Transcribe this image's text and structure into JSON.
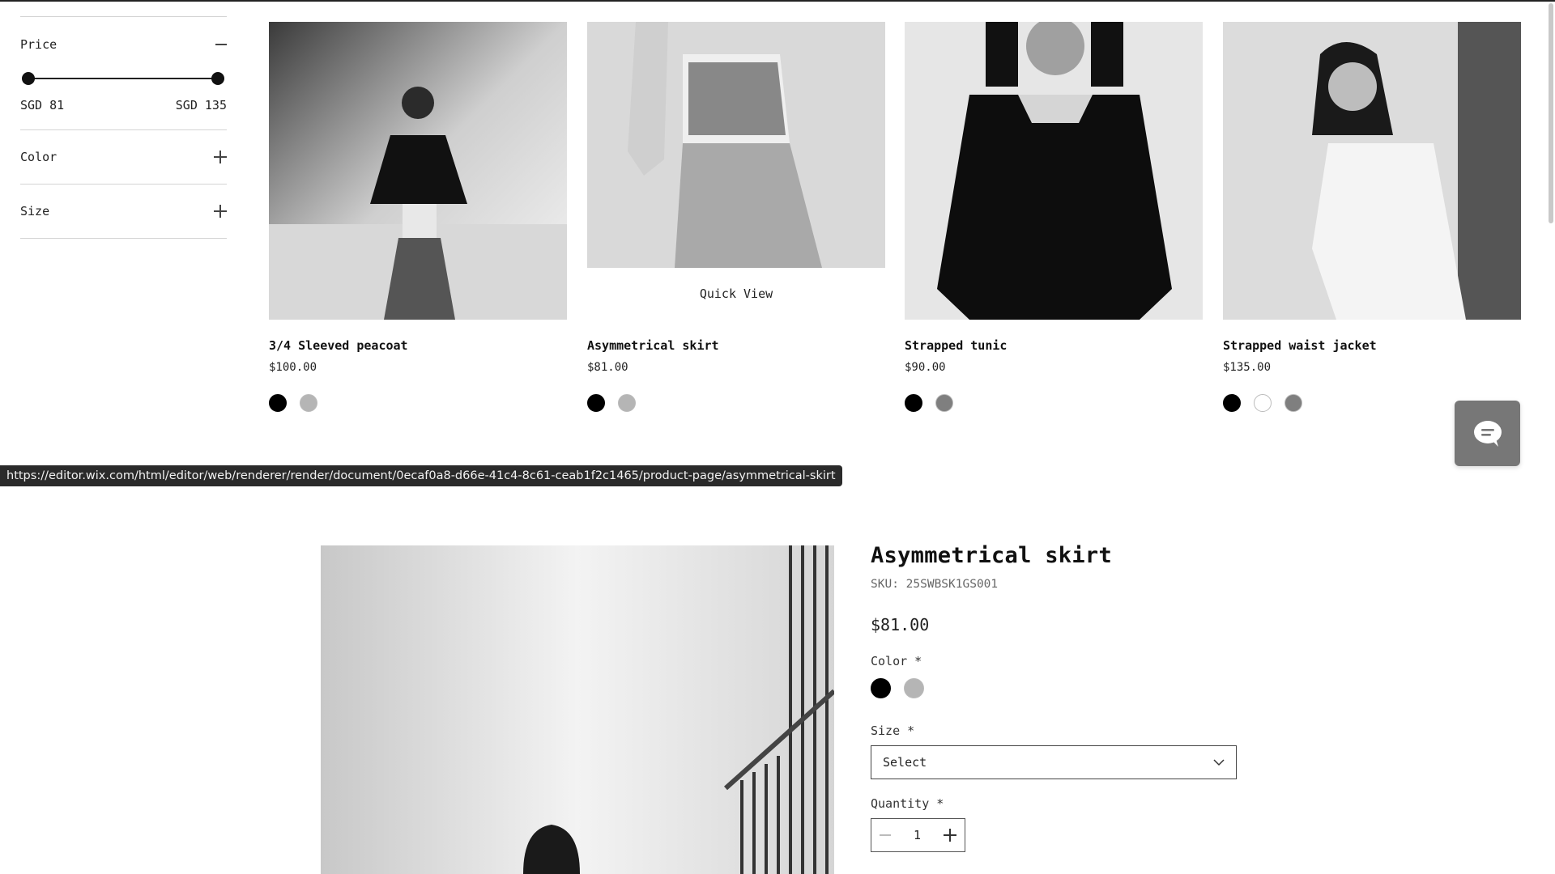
{
  "filters": {
    "price": {
      "label": "Price",
      "min_label": "SGD 81",
      "max_label": "SGD 135",
      "selected_min_fraction": 0.0,
      "selected_max_fraction": 1.0
    },
    "color": {
      "label": "Color"
    },
    "size": {
      "label": "Size"
    }
  },
  "products": [
    {
      "name": "3/4 Sleeved peacoat",
      "price": "$100.00",
      "swatches": [
        "#000000",
        "#b5b5b5"
      ]
    },
    {
      "name": "Asymmetrical skirt",
      "price": "$81.00",
      "swatches": [
        "#000000",
        "#b5b5b5"
      ],
      "quick_view": "Quick View"
    },
    {
      "name": "Strapped tunic",
      "price": "$90.00",
      "swatches": [
        "#000000",
        "#7f7f7f"
      ]
    },
    {
      "name": "Strapped waist jacket",
      "price": "$135.00",
      "swatches": [
        "#000000",
        "#ffffff",
        "#7f7f7f"
      ]
    }
  ],
  "status_url": "https://editor.wix.com/html/editor/web/renderer/render/document/0ecaf0a8-d66e-41c4-8c61-ceab1f2c1465/product-page/asymmetrical-skirt",
  "chat": {
    "icon": "chat-bubble-icon"
  },
  "detail": {
    "title": "Asymmetrical skirt",
    "sku": "SKU: 25SWBSK1GS001",
    "price": "$81.00",
    "color_label": "Color *",
    "color_swatches": [
      "#000000",
      "#b5b5b5"
    ],
    "size_label": "Size *",
    "size_select_value": "Select",
    "quantity_label": "Quantity *",
    "quantity_value": "1"
  }
}
